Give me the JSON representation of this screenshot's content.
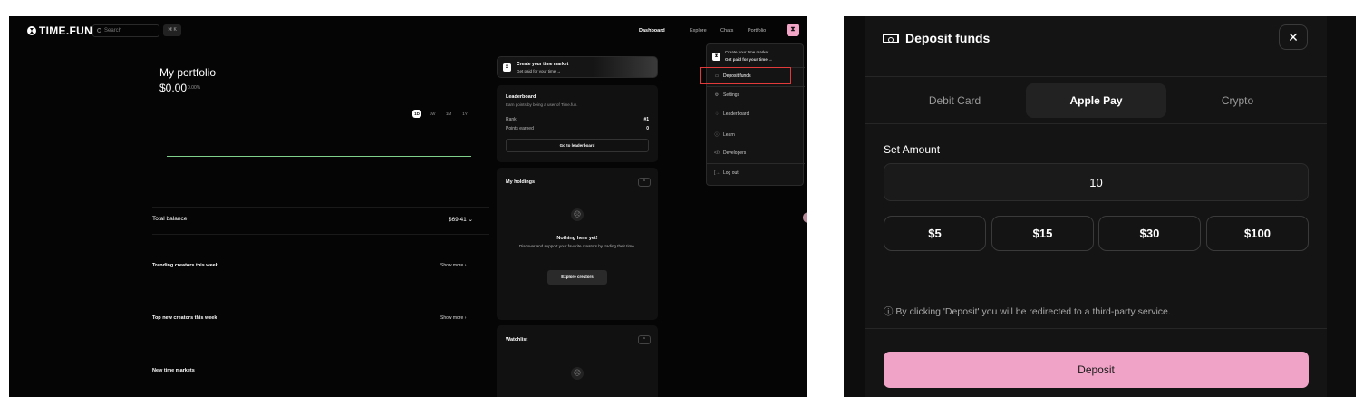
{
  "left": {
    "header": {
      "logo": "TIME.FUN",
      "search_placeholder": "Search",
      "shortcut": "⌘ K",
      "nav": [
        "Dashboard",
        "Explore",
        "Chats",
        "Portfolio"
      ],
      "avatar_glyph": "⧗"
    },
    "portfolio": {
      "title": "My portfolio",
      "value": "$0.00",
      "change": "0.00%",
      "ranges": [
        "1D",
        "1W",
        "1M",
        "1Y"
      ],
      "line_color": "#7fd08a"
    },
    "rows": {
      "total_balance_label": "Total balance",
      "total_balance_value": "$69.41",
      "trending_label": "Trending creators this week",
      "top_new_label": "Top new creators this week",
      "new_markets_label": "New time markets",
      "show_more": "Show more"
    },
    "promo": {
      "title": "Create your time market",
      "subtitle": "Get paid for your time →"
    },
    "leaderboard": {
      "title": "Leaderboard",
      "subtitle": "Earn points by being a user of Time.fun.",
      "rank_label": "Rank",
      "rank_value": "#1",
      "points_label": "Points earned",
      "points_value": "0",
      "button": "Go to leaderboard"
    },
    "holdings": {
      "title": "My holdings",
      "empty_title": "Nothing here yet!",
      "empty_text": "Discover and support your favorite creators by trading their time.",
      "button": "Explore creators"
    },
    "watchlist": {
      "title": "Watchlist"
    },
    "dropdown": {
      "promo_title": "Create your time market",
      "promo_sub": "Get paid for your time →",
      "items": [
        "Deposit funds",
        "Settings",
        "Leaderboard",
        "Learn",
        "Developers",
        "Log out"
      ]
    },
    "colors": {
      "accent_pink": "#f3a5c8",
      "highlight": "#e23a3a"
    }
  },
  "modal": {
    "title": "Deposit funds",
    "close": "✕",
    "tabs": [
      "Debit Card",
      "Apple Pay",
      "Crypto"
    ],
    "active_tab": "Apple Pay",
    "set_amount_label": "Set Amount",
    "amount_value": "10",
    "presets": [
      "$5",
      "$15",
      "$30",
      "$100"
    ],
    "disclaimer": "ⓘ By clicking 'Deposit' you will be redirected to a third-party service.",
    "deposit_button": "Deposit",
    "colors": {
      "deposit_button": "#f0a3c6"
    }
  }
}
